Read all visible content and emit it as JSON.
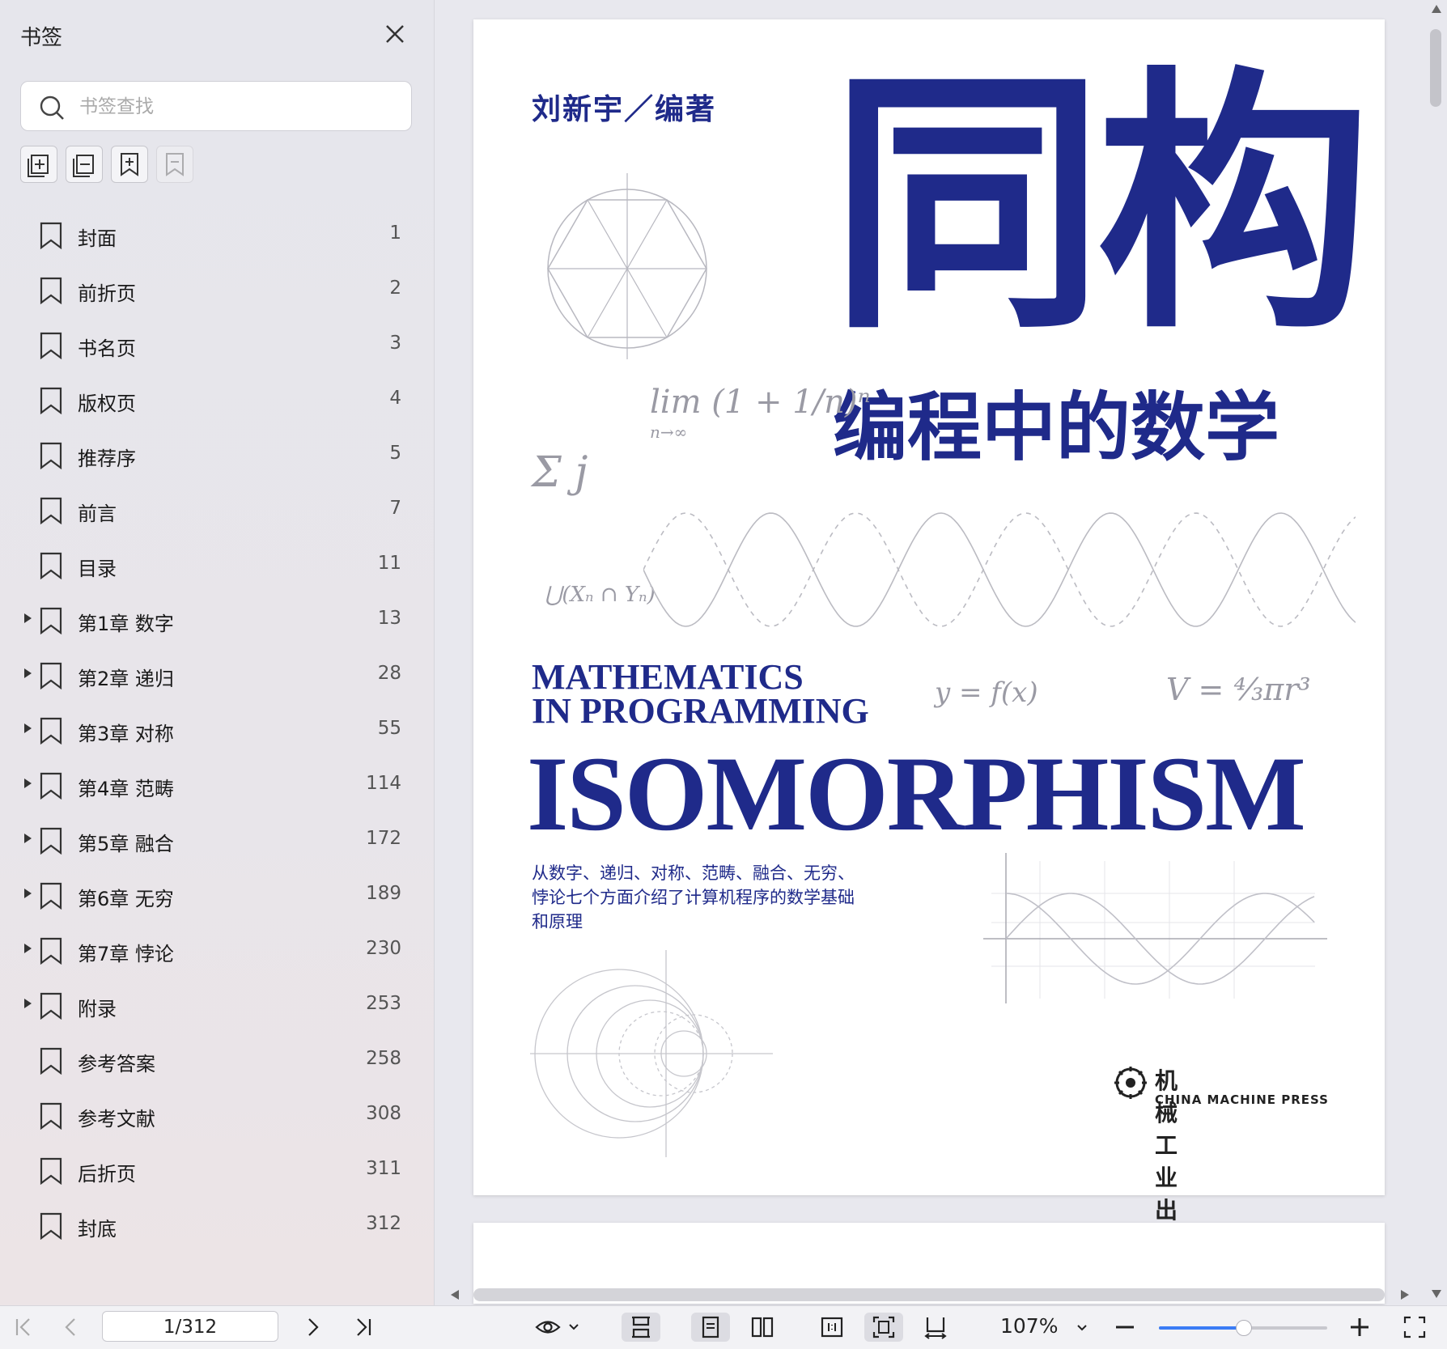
{
  "sidebar": {
    "title": "书签",
    "search_placeholder": "书签查找",
    "items": [
      {
        "label": "封面",
        "page": "1",
        "expandable": false
      },
      {
        "label": "前折页",
        "page": "2",
        "expandable": false
      },
      {
        "label": "书名页",
        "page": "3",
        "expandable": false
      },
      {
        "label": "版权页",
        "page": "4",
        "expandable": false
      },
      {
        "label": "推荐序",
        "page": "5",
        "expandable": false
      },
      {
        "label": "前言",
        "page": "7",
        "expandable": false
      },
      {
        "label": "目录",
        "page": "11",
        "expandable": false
      },
      {
        "label": "第1章 数字",
        "page": "13",
        "expandable": true
      },
      {
        "label": "第2章 递归",
        "page": "28",
        "expandable": true
      },
      {
        "label": "第3章 对称",
        "page": "55",
        "expandable": true
      },
      {
        "label": "第4章 范畴",
        "page": "114",
        "expandable": true
      },
      {
        "label": "第5章 融合",
        "page": "172",
        "expandable": true
      },
      {
        "label": "第6章 无穷",
        "page": "189",
        "expandable": true
      },
      {
        "label": "第7章 悖论",
        "page": "230",
        "expandable": true
      },
      {
        "label": "附录",
        "page": "253",
        "expandable": true
      },
      {
        "label": "参考答案",
        "page": "258",
        "expandable": false
      },
      {
        "label": "参考文献",
        "page": "308",
        "expandable": false
      },
      {
        "label": "后折页",
        "page": "311",
        "expandable": false
      },
      {
        "label": "封底",
        "page": "312",
        "expandable": false
      }
    ]
  },
  "cover": {
    "author": "刘新宇／编著",
    "title_cn": "同构",
    "subtitle_cn": "编程中的数学",
    "title_en_line1": "MATHEMATICS",
    "title_en_line2": "IN PROGRAMMING",
    "title_en_main": "ISOMORPHISM",
    "description": "从数字、递归、对称、范畴、融合、无穷、悖论七个方面介绍了计算机程序的数学基础和原理",
    "formula_y": "y = f(x)",
    "formula_v": "V = ⁴⁄₃πr³",
    "formula_lim": "lim (1 + 1/n)ⁿ",
    "formula_lim_sub": "n→∞",
    "formula_sum": "Σ j",
    "formula_union": "⋃(Xₙ ∩ Yₙ)",
    "publisher_cn": "机械工业出版社",
    "publisher_en": "CHINA MACHINE PRESS",
    "brand_color": "#1f2a8a"
  },
  "toolbar": {
    "page_indicator": "1/312",
    "zoom": "107%",
    "zoom_fraction": 0.5,
    "accent_color": "#3b7cf5"
  }
}
